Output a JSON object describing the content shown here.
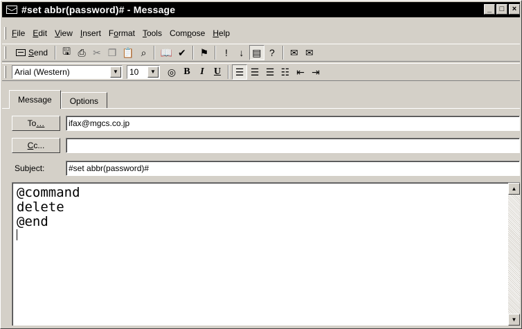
{
  "window": {
    "title": "#set abbr(password)# - Message",
    "controls": {
      "minimize": "_",
      "maximize": "□",
      "close": "×"
    }
  },
  "menu": [
    {
      "pre": "",
      "key": "F",
      "post": "ile"
    },
    {
      "pre": "",
      "key": "E",
      "post": "dit"
    },
    {
      "pre": "",
      "key": "V",
      "post": "iew"
    },
    {
      "pre": "",
      "key": "I",
      "post": "nsert"
    },
    {
      "pre": "F",
      "key": "o",
      "post": "rmat"
    },
    {
      "pre": "",
      "key": "T",
      "post": "ools"
    },
    {
      "pre": "Com",
      "key": "p",
      "post": "ose"
    },
    {
      "pre": "",
      "key": "H",
      "post": "elp"
    }
  ],
  "toolbar": {
    "send": {
      "key": "S",
      "post": "end"
    }
  },
  "format_bar": {
    "font": "Arial (Western)",
    "size": "10",
    "bold": "B",
    "italic": "I",
    "underline": "U"
  },
  "tabs": [
    {
      "label": "Message",
      "active": true
    },
    {
      "label": "Options",
      "active": false
    }
  ],
  "fields": {
    "to_button": {
      "pre": "To",
      "key": "…",
      "post": ""
    },
    "to_value": "ifax@mgcs.co.jp",
    "cc_button": {
      "key": "C",
      "post": "c..."
    },
    "cc_value": "",
    "subject_label": {
      "pre": "Sub",
      "key": "j",
      "post": "ect:"
    },
    "subject_value": "#set abbr(password)#"
  },
  "body": {
    "text": "@command\ndelete\n@end"
  }
}
